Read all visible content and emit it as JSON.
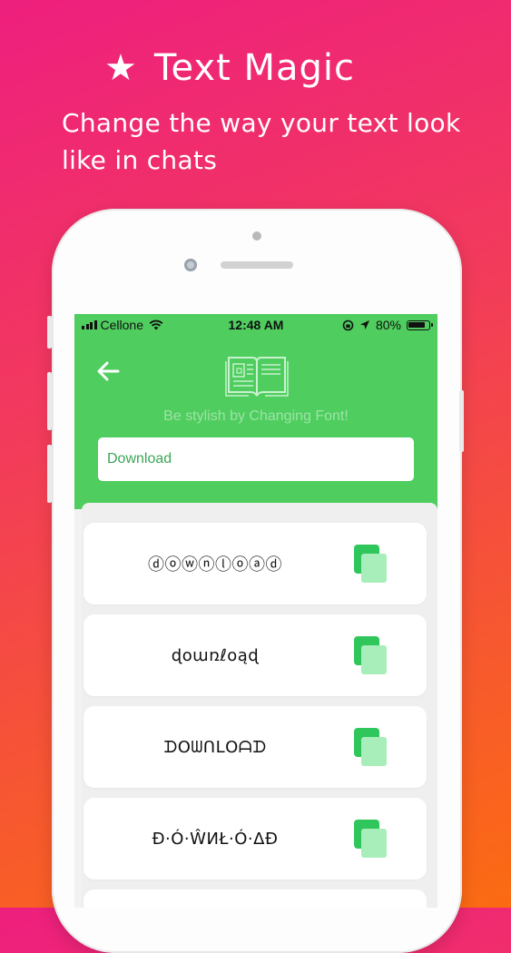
{
  "promo": {
    "star": "★",
    "title": "Text Magic",
    "subtitle": "Change the way your text look like in chats"
  },
  "status_bar": {
    "carrier": "Cellone",
    "time": "12:48 AM",
    "battery": "80%"
  },
  "header": {
    "tagline": "Be stylish by Changing Font!"
  },
  "search": {
    "value": "Download"
  },
  "fonts": [
    {
      "text": "ⓓⓞⓦⓝⓛⓞⓐⓓ"
    },
    {
      "text": "ɖօառℓօąɖ"
    },
    {
      "text": "ᗪOᗯᑎᒪOᗩᗪ"
    },
    {
      "text": "Ð·Ó·ŴИŁ·Ó·ΔÐ"
    }
  ],
  "colors": {
    "header_green": "#4fcd5f",
    "copy_green": "#2fc75b",
    "copy_light": "#a8eeba"
  }
}
